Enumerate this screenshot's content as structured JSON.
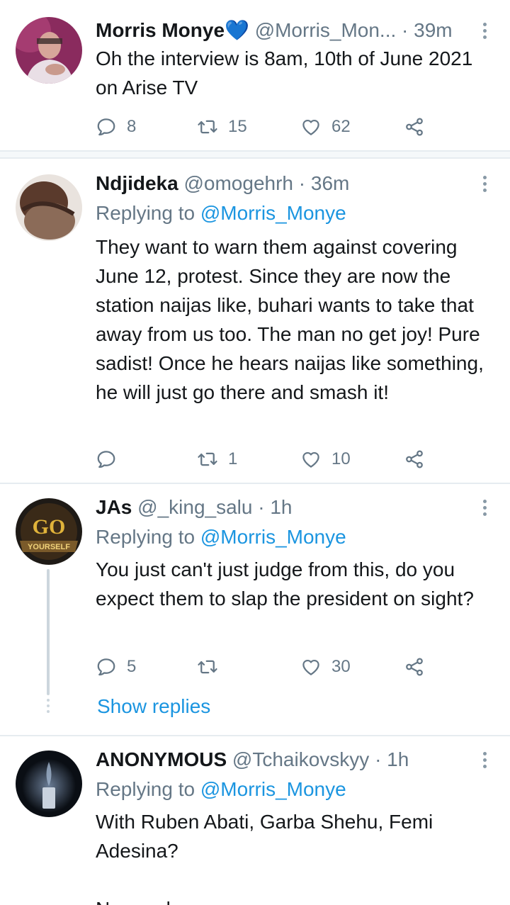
{
  "tweets": [
    {
      "name": "Morris Monye",
      "name_emoji": "💙",
      "handle": "@Morris_Mon...",
      "dot": "·",
      "time": "39m",
      "text": "Oh the interview is 8am, 10th of June 2021 on Arise TV",
      "replies": "8",
      "retweets": "15",
      "likes": "62"
    },
    {
      "name": "Ndjideka",
      "handle": "@omogehrh",
      "dot": "·",
      "time": "36m",
      "replying_prefix": "Replying to",
      "replying_to": "@Morris_Monye",
      "text": "They want to warn them against covering June 12, protest. Since they are now the station naijas like, buhari wants to take that away from us too. The man no get joy! Pure sadist! Once he hears naijas like something, he will just go there and smash it!",
      "replies": "",
      "retweets": "1",
      "likes": "10"
    },
    {
      "name": "JAs",
      "handle": "@_king_salu",
      "dot": "·",
      "time": "1h",
      "replying_prefix": "Replying to",
      "replying_to": "@Morris_Monye",
      "text": "You just can't just judge from this, do you expect them to slap the president on sight?",
      "replies": "5",
      "retweets": "",
      "likes": "30",
      "avatar_text_top": "GO",
      "avatar_text_bottom": "YOURSELF",
      "show_replies": "Show replies"
    },
    {
      "name": "ANONYMOUS",
      "handle": "@Tchaikovskyy",
      "dot": "·",
      "time": "1h",
      "replying_prefix": "Replying to",
      "replying_to": "@Morris_Monye",
      "text": "With Ruben Abati, Garba Shehu, Femi Adesina?",
      "text_cut": "No need"
    }
  ],
  "colors": {
    "link": "#1b95e0",
    "muted": "#657786",
    "divider": "#e6ecf0"
  },
  "icons": [
    "reply-icon",
    "retweet-icon",
    "like-icon",
    "share-icon",
    "more-icon"
  ]
}
